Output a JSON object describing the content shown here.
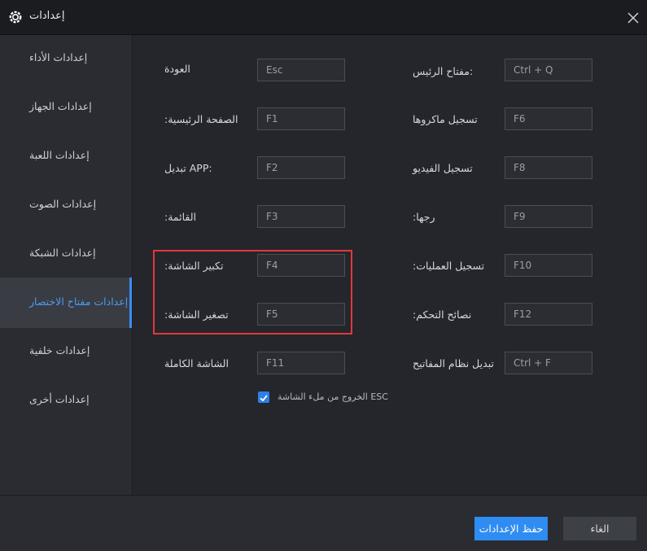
{
  "window": {
    "title": "إعدادات",
    "icon": "gear-icon",
    "close_icon": "close-icon"
  },
  "sidebar": {
    "items": [
      {
        "label": "إعدادات الأداء",
        "active": false
      },
      {
        "label": "إعدادات الجهاز",
        "active": false
      },
      {
        "label": "إعدادات اللعبة",
        "active": false
      },
      {
        "label": "إعدادات الصوت",
        "active": false
      },
      {
        "label": "إعدادات الشبكة",
        "active": false
      },
      {
        "label": "إعدادات مفتاح الاختصار",
        "active": true
      },
      {
        "label": "إعدادات خلفية",
        "active": false
      },
      {
        "label": "إعدادات أخرى",
        "active": false
      }
    ]
  },
  "shortcuts": {
    "left": [
      {
        "label": "العودة",
        "key": "Esc"
      },
      {
        "label": ":الصفحة الرئيسية",
        "key": "F1"
      },
      {
        "label": "تبديل APP:",
        "key": "F2"
      },
      {
        "label": ":القائمة",
        "key": "F3"
      },
      {
        "label": ":تكبير الشاشة",
        "key": "F4"
      },
      {
        "label": ":تصغير الشاشة",
        "key": "F5"
      },
      {
        "label": "الشاشة الكاملة",
        "key": "F11"
      }
    ],
    "right": [
      {
        "label": "مفتاح الرئيس:",
        "key": "Ctrl + Q"
      },
      {
        "label": "تسجيل ماكروها",
        "key": "F6"
      },
      {
        "label": "تسجيل الفيديو",
        "key": "F8"
      },
      {
        "label": ":رجها",
        "key": "F9"
      },
      {
        "label": ":تسجيل العمليات",
        "key": "F10"
      },
      {
        "label": ":نصائح التحكم",
        "key": "F12"
      },
      {
        "label": "تبديل نظام المفاتيح",
        "key": "Ctrl + F"
      }
    ]
  },
  "esc_exit": {
    "label": "الخروج من ملء الشاشة ESC",
    "checked": true
  },
  "footer": {
    "save_label": "حفظ الإعدادات",
    "cancel_label": "الغاء"
  },
  "colors": {
    "accent": "#2f8cf2",
    "highlight_border": "#e0393b",
    "active_text": "#4a9cf2"
  }
}
